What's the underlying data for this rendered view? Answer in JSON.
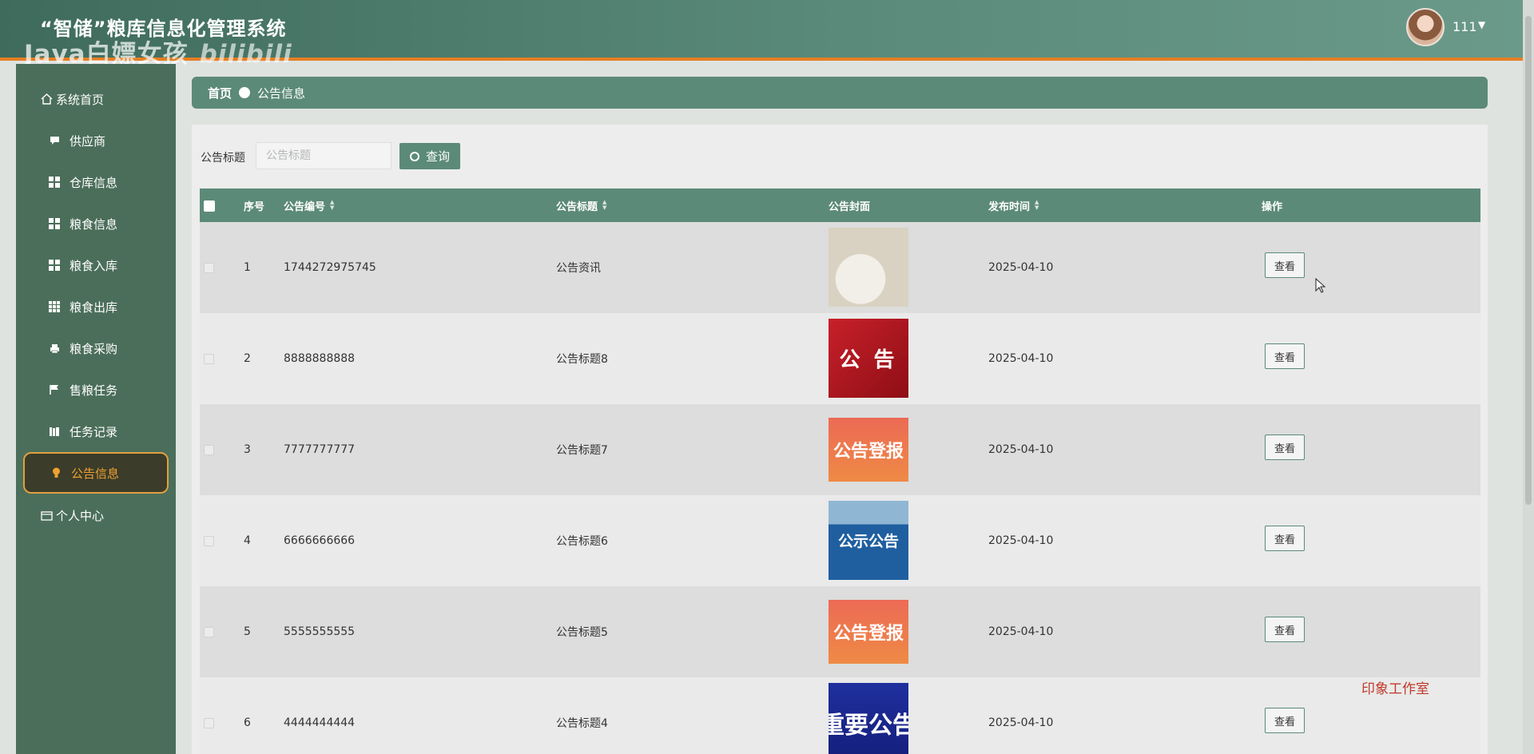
{
  "header": {
    "app_title": "“智储”粮库信息化管理系统",
    "watermark": "Java白嫖女孩",
    "watermark_logo": "bilibili",
    "username": "111",
    "accent_color": "#e67e22"
  },
  "sidebar": {
    "items": [
      {
        "label": "系统首页",
        "icon": "home-icon"
      },
      {
        "label": "供应商",
        "icon": "chat-icon"
      },
      {
        "label": "仓库信息",
        "icon": "grid-icon"
      },
      {
        "label": "粮食信息",
        "icon": "grid-icon"
      },
      {
        "label": "粮食入库",
        "icon": "grid-icon"
      },
      {
        "label": "粮食出库",
        "icon": "grid-icon"
      },
      {
        "label": "粮食采购",
        "icon": "printer-icon"
      },
      {
        "label": "售粮任务",
        "icon": "flag-icon"
      },
      {
        "label": "任务记录",
        "icon": "books-icon"
      },
      {
        "label": "公告信息",
        "icon": "bulb-icon",
        "active": true
      },
      {
        "label": "个人中心",
        "icon": "wallet-icon"
      }
    ]
  },
  "breadcrumb": {
    "home": "首页",
    "current": "公告信息"
  },
  "search": {
    "label": "公告标题",
    "placeholder": "公告标题",
    "value": "",
    "button_label": "查询"
  },
  "table": {
    "columns": [
      "序号",
      "公告编号",
      "公告标题",
      "公告封面",
      "发布时间",
      "操作"
    ],
    "rows": [
      {
        "index": "1",
        "code": "1744272975745",
        "title": "公告资讯",
        "cover_text": "",
        "cover_style": "rice",
        "date": "2025-04-10",
        "action": "查看"
      },
      {
        "index": "2",
        "code": "8888888888",
        "title": "公告标题8",
        "cover_text": "公 告",
        "cover_style": "red",
        "date": "2025-04-10",
        "action": "查看"
      },
      {
        "index": "3",
        "code": "7777777777",
        "title": "公告标题7",
        "cover_text": "公告登报",
        "cover_style": "orange",
        "date": "2025-04-10",
        "action": "查看"
      },
      {
        "index": "4",
        "code": "6666666666",
        "title": "公告标题6",
        "cover_text": "公示公告",
        "cover_style": "blue",
        "date": "2025-04-10",
        "action": "查看"
      },
      {
        "index": "5",
        "code": "5555555555",
        "title": "公告标题5",
        "cover_text": "公告登报",
        "cover_style": "orange",
        "date": "2025-04-10",
        "action": "查看"
      },
      {
        "index": "6",
        "code": "4444444444",
        "title": "公告标题4",
        "cover_text": "重要公告",
        "cover_style": "navy",
        "date": "2025-04-10",
        "action": "查看"
      }
    ]
  },
  "footer_watermark": "印象工作室",
  "colors": {
    "primary": "#5c8a78",
    "sidebar": "#4b6e5a",
    "active_border": "#e0a040"
  }
}
